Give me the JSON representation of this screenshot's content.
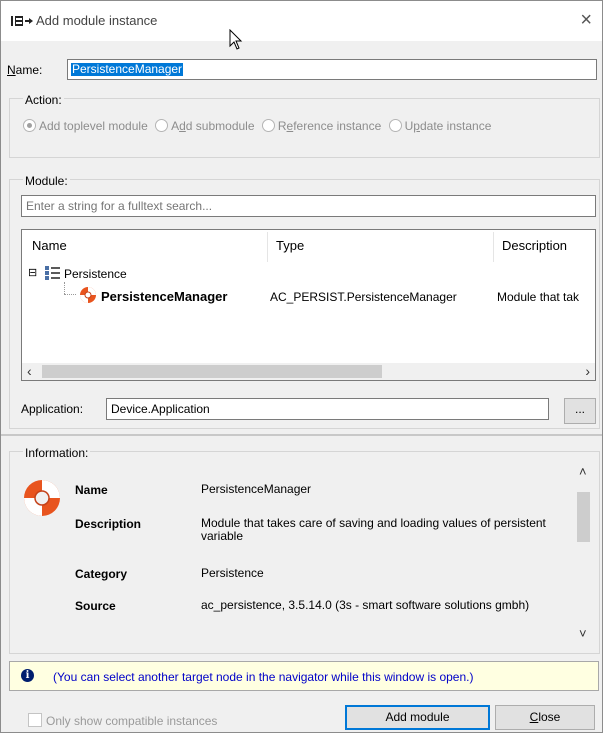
{
  "window": {
    "title": "Add module instance",
    "close_glyph": "×"
  },
  "name_field": {
    "label_prefix": "",
    "label_mnemonic": "N",
    "label_rest": "ame:",
    "value": "PersistenceManager"
  },
  "action": {
    "group_label": "Action:",
    "options": [
      {
        "pre": "Add toplevel module",
        "mn": "",
        "post": "",
        "selected": true
      },
      {
        "pre": "A",
        "mn": "d",
        "post": "d submodule",
        "selected": false
      },
      {
        "pre": "R",
        "mn": "e",
        "post": "ference instance",
        "selected": false
      },
      {
        "pre": "U",
        "mn": "p",
        "post": "date instance",
        "selected": false
      }
    ]
  },
  "module": {
    "group_label": "Module:",
    "search_placeholder": "Enter a string for a fulltext search...",
    "columns": [
      "Name",
      "Type",
      "Description"
    ],
    "tree": {
      "parent": {
        "label": "Persistence",
        "expander": "⊟"
      },
      "child": {
        "name": "PersistenceManager",
        "type": "AC_PERSIST.PersistenceManager",
        "description": "Module that tak"
      }
    },
    "scroll_left": "‹",
    "scroll_right": "›"
  },
  "application": {
    "label": "Application:",
    "value": "Device.Application",
    "browse_label": "..."
  },
  "information": {
    "group_label": "Information:",
    "rows": [
      {
        "key": "Name",
        "value": "PersistenceManager"
      },
      {
        "key": "Description",
        "value": "Module that takes care of saving and loading values of persistent variable"
      },
      {
        "key": "Category",
        "value": "Persistence"
      },
      {
        "key": "Source",
        "value": "ac_persistence, 3.5.14.0 (3s - smart software solutions gmbh)"
      }
    ],
    "scroll_up": "˄",
    "scroll_down": "˅"
  },
  "note": {
    "icon": "info-icon",
    "icon_glyph": "i",
    "text": "(You can select another target node in the navigator while this window is open.)"
  },
  "footer": {
    "checkbox_label": "Only show compatible instances",
    "checkbox_checked": false,
    "add_button": "Add module",
    "close_mn": "C",
    "close_rest": "lose"
  },
  "colors": {
    "selection": "#0078d7",
    "note_background": "#ffffe1",
    "note_text": "#0000c8",
    "lifebuoy_red": "#e8541e"
  }
}
